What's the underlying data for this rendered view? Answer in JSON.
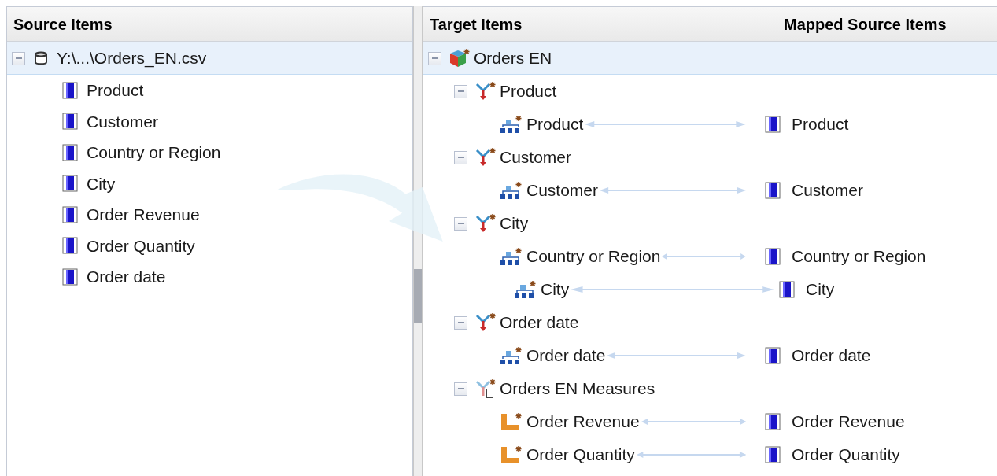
{
  "source_panel": {
    "title": "Source Items",
    "root": {
      "label": "Y:\\...\\Orders_EN.csv",
      "kind": "file",
      "expanded": true,
      "selected": true
    },
    "items": [
      {
        "label": "Product",
        "kind": "column"
      },
      {
        "label": "Customer",
        "kind": "column"
      },
      {
        "label": "Country or Region",
        "kind": "column"
      },
      {
        "label": "City",
        "kind": "column"
      },
      {
        "label": "Order Revenue",
        "kind": "column"
      },
      {
        "label": "Order Quantity",
        "kind": "column"
      },
      {
        "label": "Order date",
        "kind": "column"
      }
    ]
  },
  "target_panel": {
    "columns": [
      "Target Items",
      "Mapped Source Items"
    ],
    "tree": [
      {
        "label": "Orders EN",
        "kind": "cube",
        "expanded": true,
        "selected": true,
        "children": [
          {
            "label": "Product",
            "kind": "dimension",
            "expanded": true,
            "children": [
              {
                "label": "Product",
                "kind": "level",
                "mapped": "Product"
              }
            ]
          },
          {
            "label": "Customer",
            "kind": "dimension",
            "expanded": true,
            "children": [
              {
                "label": "Customer",
                "kind": "level",
                "mapped": "Customer"
              }
            ]
          },
          {
            "label": "City",
            "kind": "dimension",
            "expanded": true,
            "children": [
              {
                "label": "Country or Region",
                "kind": "level",
                "mapped": "Country or Region",
                "children": [
                  {
                    "label": "City",
                    "kind": "level",
                    "mapped": "City"
                  }
                ]
              }
            ]
          },
          {
            "label": "Order date",
            "kind": "dimension",
            "expanded": true,
            "children": [
              {
                "label": "Order date",
                "kind": "level",
                "mapped": "Order date"
              }
            ]
          },
          {
            "label": "Orders EN Measures",
            "kind": "measures",
            "expanded": true,
            "children": [
              {
                "label": "Order Revenue",
                "kind": "measure",
                "mapped": "Order Revenue"
              },
              {
                "label": "Order Quantity",
                "kind": "measure",
                "mapped": "Order Quantity"
              }
            ]
          }
        ]
      }
    ]
  }
}
